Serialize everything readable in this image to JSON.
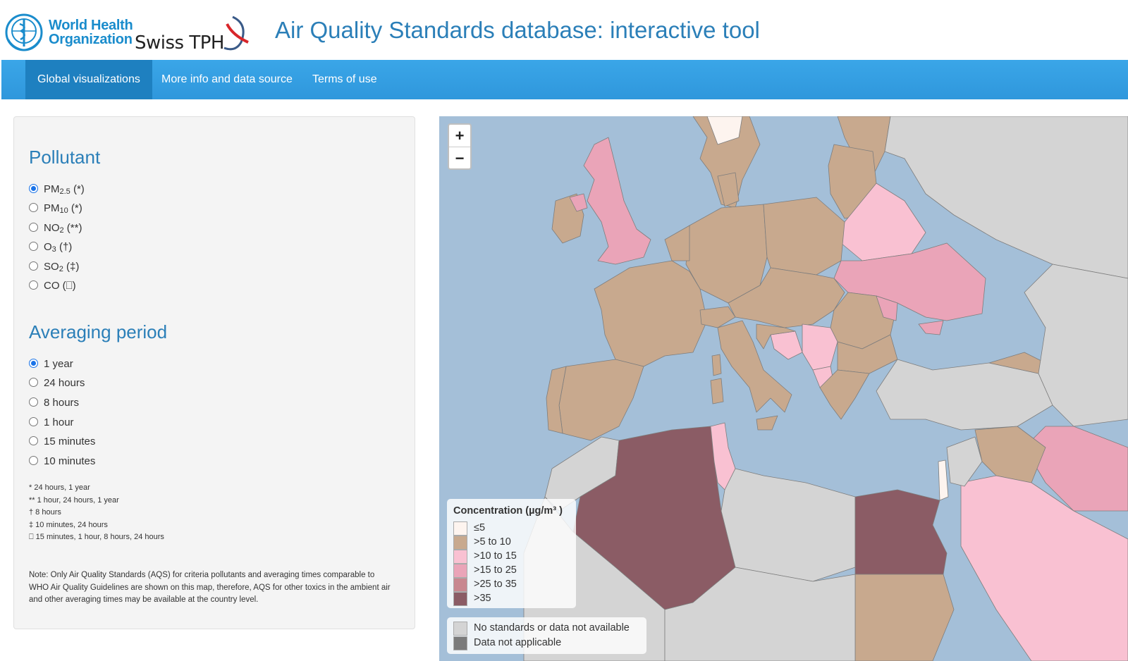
{
  "header": {
    "who_line1": "World Health",
    "who_line2": "Organization",
    "swiss_tph": "Swiss TPH",
    "title": "Air Quality Standards database: interactive tool"
  },
  "nav": {
    "items": [
      {
        "label": "Global visualizations",
        "active": true
      },
      {
        "label": "More info and data source",
        "active": false
      },
      {
        "label": "Terms of use",
        "active": false
      }
    ]
  },
  "sidebar": {
    "pollutant_title": "Pollutant",
    "pollutants": [
      {
        "base": "PM",
        "sub": "2.5",
        "suffix": " (*)",
        "selected": true
      },
      {
        "base": "PM",
        "sub": "10",
        "suffix": " (*)",
        "selected": false
      },
      {
        "base": "NO",
        "sub": "2",
        "suffix": " (**)",
        "selected": false
      },
      {
        "base": "O",
        "sub": "3",
        "suffix": " (†)",
        "selected": false
      },
      {
        "base": "SO",
        "sub": "2",
        "suffix": " (‡)",
        "selected": false
      },
      {
        "base": "CO",
        "sub": "",
        "suffix": " (⎕)",
        "selected": false
      }
    ],
    "averaging_title": "Averaging period",
    "periods": [
      {
        "label": "1 year",
        "selected": true
      },
      {
        "label": "24 hours",
        "selected": false
      },
      {
        "label": "8 hours",
        "selected": false
      },
      {
        "label": "1 hour",
        "selected": false
      },
      {
        "label": "15 minutes",
        "selected": false
      },
      {
        "label": "10 minutes",
        "selected": false
      }
    ],
    "footnotes": [
      "* 24 hours, 1 year",
      "** 1 hour, 24 hours, 1 year",
      "† 8 hours",
      "‡ 10 minutes, 24 hours",
      "⎕ 15 minutes, 1 hour, 8 hours, 24 hours"
    ],
    "note": "Note: Only Air Quality Standards (AQS) for criteria pollutants and averaging times comparable to WHO Air Quality Guidelines are shown on this map, therefore, AQS for other toxics in the ambient air and other averaging times may be available at the country level."
  },
  "map": {
    "zoom_in": "+",
    "zoom_out": "−",
    "legend_title": "Concentration (µg/m³ )",
    "legend_items": [
      {
        "label": "≤5",
        "color": "#fdf4ef"
      },
      {
        "label": ">5 to 10",
        "color": "#c8a98e"
      },
      {
        "label": ">10 to 15",
        "color": "#f9c1d2"
      },
      {
        "label": ">15 to 25",
        "color": "#eaa4b8"
      },
      {
        "label": ">25 to 35",
        "color": "#c8878f"
      },
      {
        "label": ">35",
        "color": "#8b5c65"
      }
    ],
    "legend2_items": [
      {
        "label": "No standards or data not available",
        "color": "#d4d4d4"
      },
      {
        "label": "Data not applicable",
        "color": "#7b7b7b"
      }
    ],
    "colors": {
      "sea": "#a4bfd8",
      "no_data": "#d4d4d4",
      "c_5_10": "#c8a98e",
      "c_10_15": "#f9c1d2",
      "c_15_25": "#eaa4b8",
      "c_gt_35": "#8b5c65"
    }
  }
}
